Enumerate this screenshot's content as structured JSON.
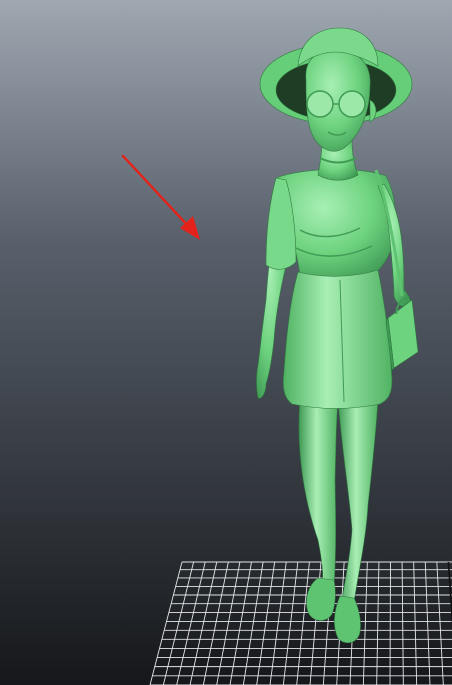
{
  "viewport": {
    "background_top": "#9fa7b1",
    "background_bottom": "#15171a",
    "grid_color": "#e4e6e8",
    "model_color": "#6ed37f",
    "model_shadow": "#3f9a54",
    "model_highlight": "#a8efb5",
    "annotation_color": "#e3231b"
  },
  "icons": {
    "annotation": "arrow-annotation-icon"
  }
}
